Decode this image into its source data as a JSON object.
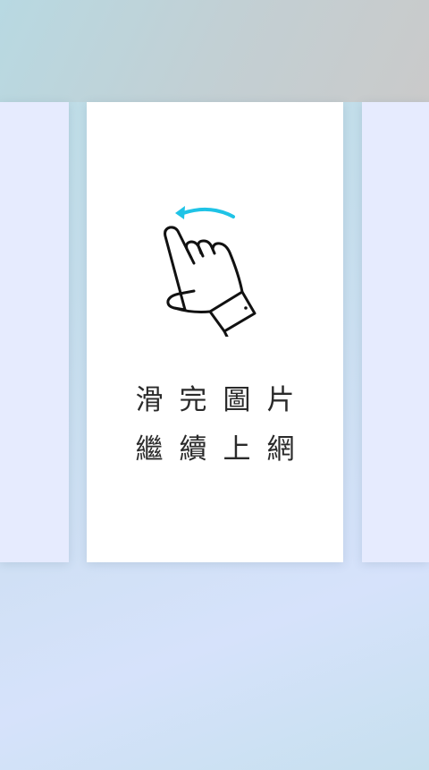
{
  "onboarding": {
    "hint_line_1": "滑完圖片",
    "hint_line_2": "繼續上網",
    "gesture_icon": "swipe-left-hand-icon"
  },
  "colors": {
    "arrow_accent": "#1fc3e6",
    "card_background": "#ffffff",
    "side_card_background": "#e6ebfe",
    "text": "#2a2a2a"
  }
}
